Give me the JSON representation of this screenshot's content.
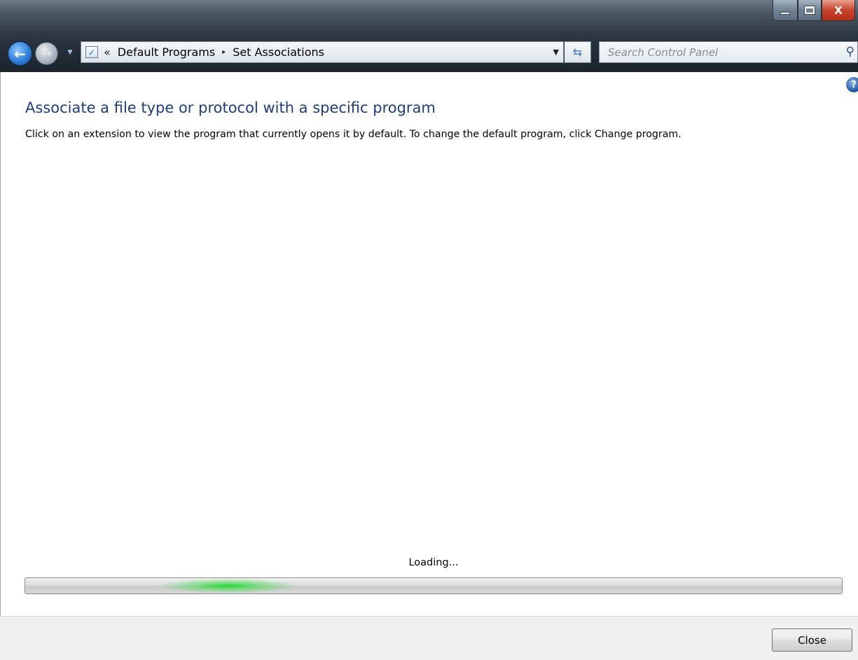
{
  "window": {
    "controls": {
      "close_glyph": "X"
    }
  },
  "nav": {
    "back_icon": "back-arrow-icon",
    "forward_icon": "forward-arrow-icon"
  },
  "address_bar": {
    "prefix": "«",
    "crumbs": [
      "Default Programs",
      "Set Associations"
    ],
    "separator": "▸"
  },
  "search": {
    "placeholder": "Search Control Panel"
  },
  "content": {
    "heading": "Associate a file type or protocol with a specific program",
    "description": "Click on an extension to view the program that currently opens it by default. To change the default program, click Change program.",
    "loading_text": "Loading..."
  },
  "footer": {
    "close_label": "Close"
  },
  "colors": {
    "heading": "#1e3d7a",
    "progress_glow": "#1bd62d"
  }
}
